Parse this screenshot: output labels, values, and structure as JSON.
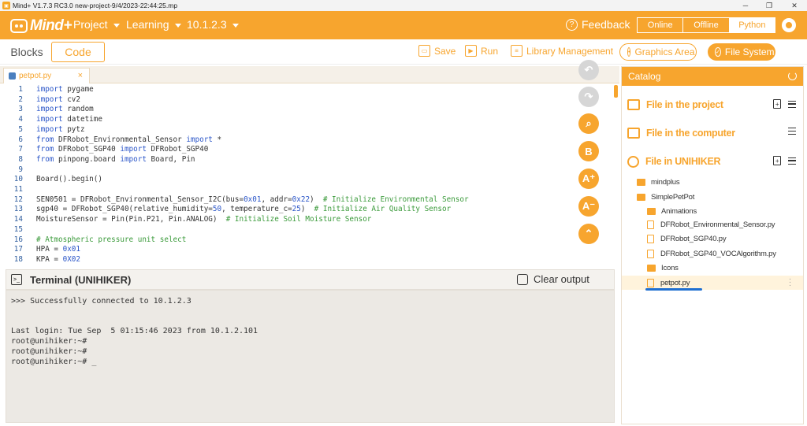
{
  "window": {
    "title": "Mind+ V1.7.3 RC3.0   new-project-9/4/2023-22:44:25.mp",
    "minimize": "─",
    "maximize": "❐",
    "close": "✕"
  },
  "menubar": {
    "logo_text": "Mind+",
    "menus": [
      "Project",
      "Learning",
      "10.1.2.3"
    ],
    "feedback": "Feedback",
    "modes": [
      "Online",
      "Offline",
      "Python"
    ],
    "active_mode": "Python",
    "accent_color": "#f7a52e"
  },
  "toolbar": {
    "tabs": [
      "Blocks",
      "Code"
    ],
    "active_tab": "Code",
    "save": "Save",
    "run": "Run",
    "library": "Library Management",
    "graphics": "Graphics Area",
    "filesystem": "File System"
  },
  "editor": {
    "file_tab": "petpot.py",
    "close": "×",
    "lines": [
      {
        "n": "1",
        "kw": "import",
        "rest": " pygame"
      },
      {
        "n": "2",
        "kw": "import",
        "rest": " cv2"
      },
      {
        "n": "3",
        "kw": "import",
        "rest": " random"
      },
      {
        "n": "4",
        "kw": "import",
        "rest": " datetime"
      },
      {
        "n": "5",
        "kw": "import",
        "rest": " pytz"
      },
      {
        "n": "6",
        "kw": "from",
        "rest": " DFRobot_Environmental_Sensor ",
        "kw2": "import",
        "rest2": " *"
      },
      {
        "n": "7",
        "kw": "from",
        "rest": " DFRobot_SGP40 ",
        "kw2": "import",
        "rest2": " DFRobot_SGP40"
      },
      {
        "n": "8",
        "kw": "from",
        "rest": " pinpong.board ",
        "kw2": "import",
        "rest2": " Board, Pin"
      },
      {
        "n": "9",
        "kw": "",
        "rest": ""
      },
      {
        "n": "10",
        "kw": "",
        "rest": "Board().begin()"
      },
      {
        "n": "11",
        "kw": "",
        "rest": ""
      },
      {
        "n": "12",
        "kw": "",
        "rest": "SEN0501 = DFRobot_Environmental_Sensor_I2C(bus=",
        "num": "0x01",
        "rest2": ", addr=",
        "num2": "0x22",
        "rest3": ")  ",
        "cm": "# Initialize Environmental Sensor"
      },
      {
        "n": "13",
        "kw": "",
        "rest": "sgp40 = DFRobot_SGP40(relative_humidity=",
        "num": "50",
        "rest2": ", temperature_c=",
        "num2": "25",
        "rest3": ")  ",
        "cm": "# Initialize Air Quality Sensor"
      },
      {
        "n": "14",
        "kw": "",
        "rest": "MoistureSensor = Pin(Pin.P21, Pin.ANALOG)  ",
        "cm": "# Initialize Soil Moisture Sensor"
      },
      {
        "n": "15",
        "kw": "",
        "rest": ""
      },
      {
        "n": "16",
        "kw": "",
        "rest": "",
        "cm": "# Atmospheric pressure unit select"
      },
      {
        "n": "17",
        "kw": "",
        "rest": "HPA = ",
        "num": "0x01"
      },
      {
        "n": "18",
        "kw": "",
        "rest": "KPA = ",
        "num": "0X02"
      }
    ],
    "side_buttons": [
      "↶",
      "↷",
      "⌕",
      "B",
      "A⁺",
      "A⁻",
      "⌃"
    ]
  },
  "terminal": {
    "title": "Terminal (UNIHIKER)",
    "clear": "Clear output",
    "lines": [
      ">>> Successfully connected to 10.1.2.3",
      "",
      "",
      "Last login: Tue Sep  5 01:15:46 2023 from 10.1.2.101",
      "root@unihiker:~#",
      "root@unihiker:~#",
      "root@unihiker:~# _"
    ]
  },
  "catalog": {
    "title": "Catalog",
    "sections": [
      "File in the project",
      "File in the computer",
      "File in UNIHIKER"
    ],
    "tree": [
      {
        "label": "mindplus",
        "type": "folder",
        "indent": 0
      },
      {
        "label": "SimplePetPot",
        "type": "folder",
        "indent": 0
      },
      {
        "label": "Animations",
        "type": "folder",
        "indent": 1
      },
      {
        "label": "DFRobot_Environmental_Sensor.py",
        "type": "file",
        "indent": 1
      },
      {
        "label": "DFRobot_SGP40.py",
        "type": "file",
        "indent": 1
      },
      {
        "label": "DFRobot_SGP40_VOCAlgorithm.py",
        "type": "file",
        "indent": 1
      },
      {
        "label": "Icons",
        "type": "folder",
        "indent": 1
      },
      {
        "label": "petpot.py",
        "type": "file",
        "indent": 1,
        "selected": true
      }
    ]
  }
}
